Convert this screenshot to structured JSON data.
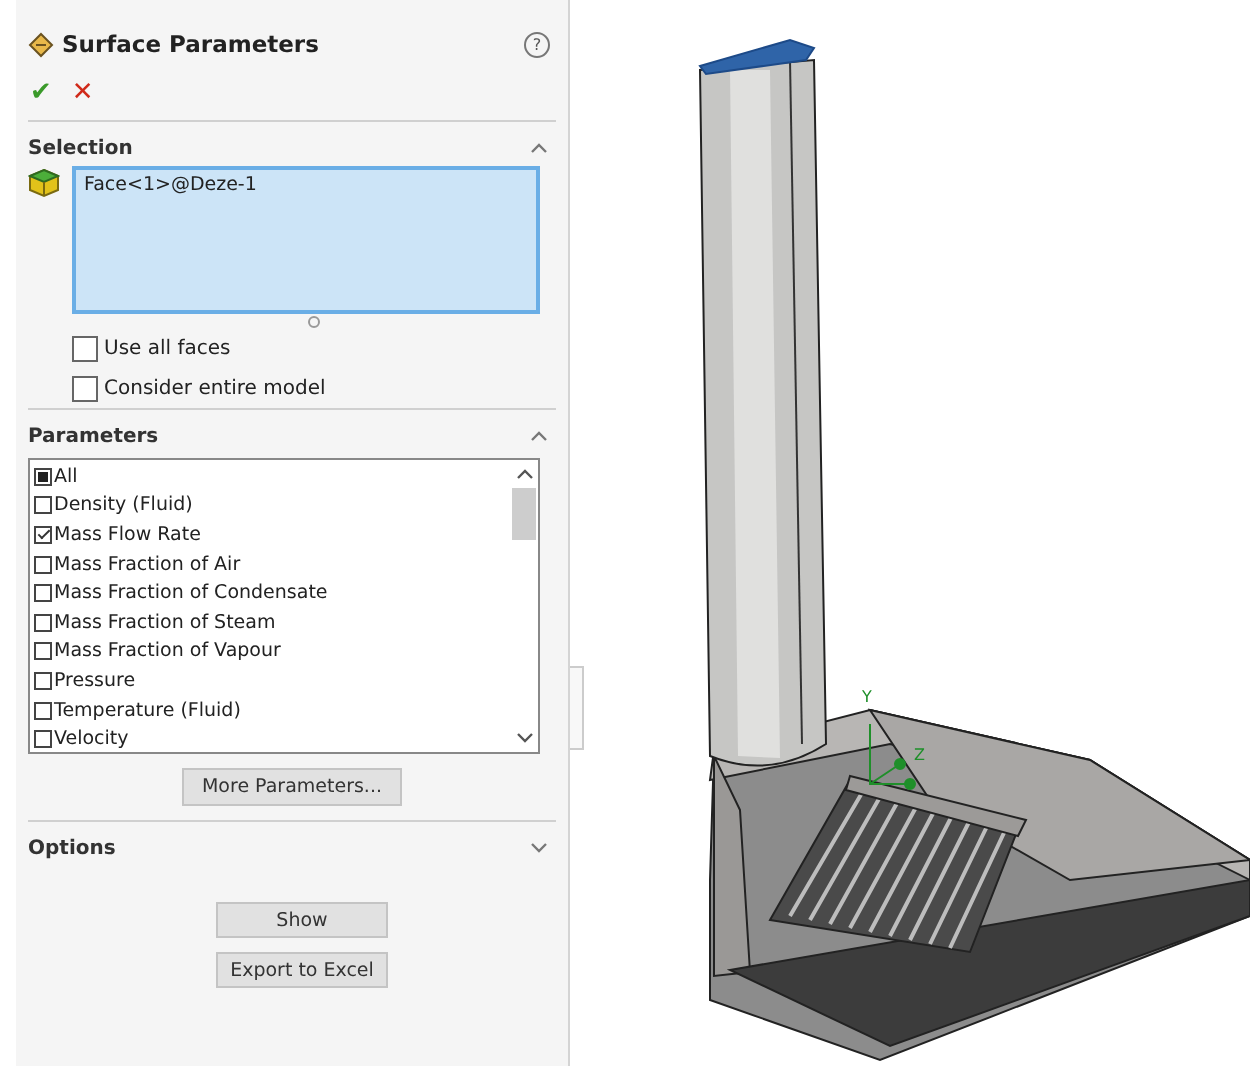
{
  "panel": {
    "title": "Surface Parameters",
    "ok": "✔",
    "cancel": "✕",
    "help": "?"
  },
  "selection": {
    "title": "Selection",
    "expanded": true,
    "items": [
      "Face<1>@Deze-1"
    ],
    "options": [
      {
        "label": "Use all faces",
        "checked": false
      },
      {
        "label": "Consider entire model",
        "checked": false
      }
    ]
  },
  "parameters": {
    "title": "Parameters",
    "expanded": true,
    "items": [
      {
        "label": "All",
        "checked": false,
        "indeterminate": true
      },
      {
        "label": "Density (Fluid)",
        "checked": false,
        "indeterminate": false
      },
      {
        "label": "Mass Flow Rate",
        "checked": true,
        "indeterminate": false
      },
      {
        "label": "Mass Fraction of Air",
        "checked": false,
        "indeterminate": false
      },
      {
        "label": "Mass Fraction of Condensate",
        "checked": false,
        "indeterminate": false
      },
      {
        "label": "Mass Fraction of Steam",
        "checked": false,
        "indeterminate": false
      },
      {
        "label": "Mass Fraction of Vapour",
        "checked": false,
        "indeterminate": false
      },
      {
        "label": "Pressure",
        "checked": false,
        "indeterminate": false
      },
      {
        "label": "Temperature (Fluid)",
        "checked": false,
        "indeterminate": false
      },
      {
        "label": "Velocity",
        "checked": false,
        "indeterminate": false
      }
    ],
    "more_button": "More Parameters..."
  },
  "options": {
    "title": "Options",
    "expanded": false
  },
  "buttons": [
    "Show",
    "Export to Excel"
  ],
  "viewport": {
    "axes": [
      "Y",
      "Z"
    ]
  }
}
